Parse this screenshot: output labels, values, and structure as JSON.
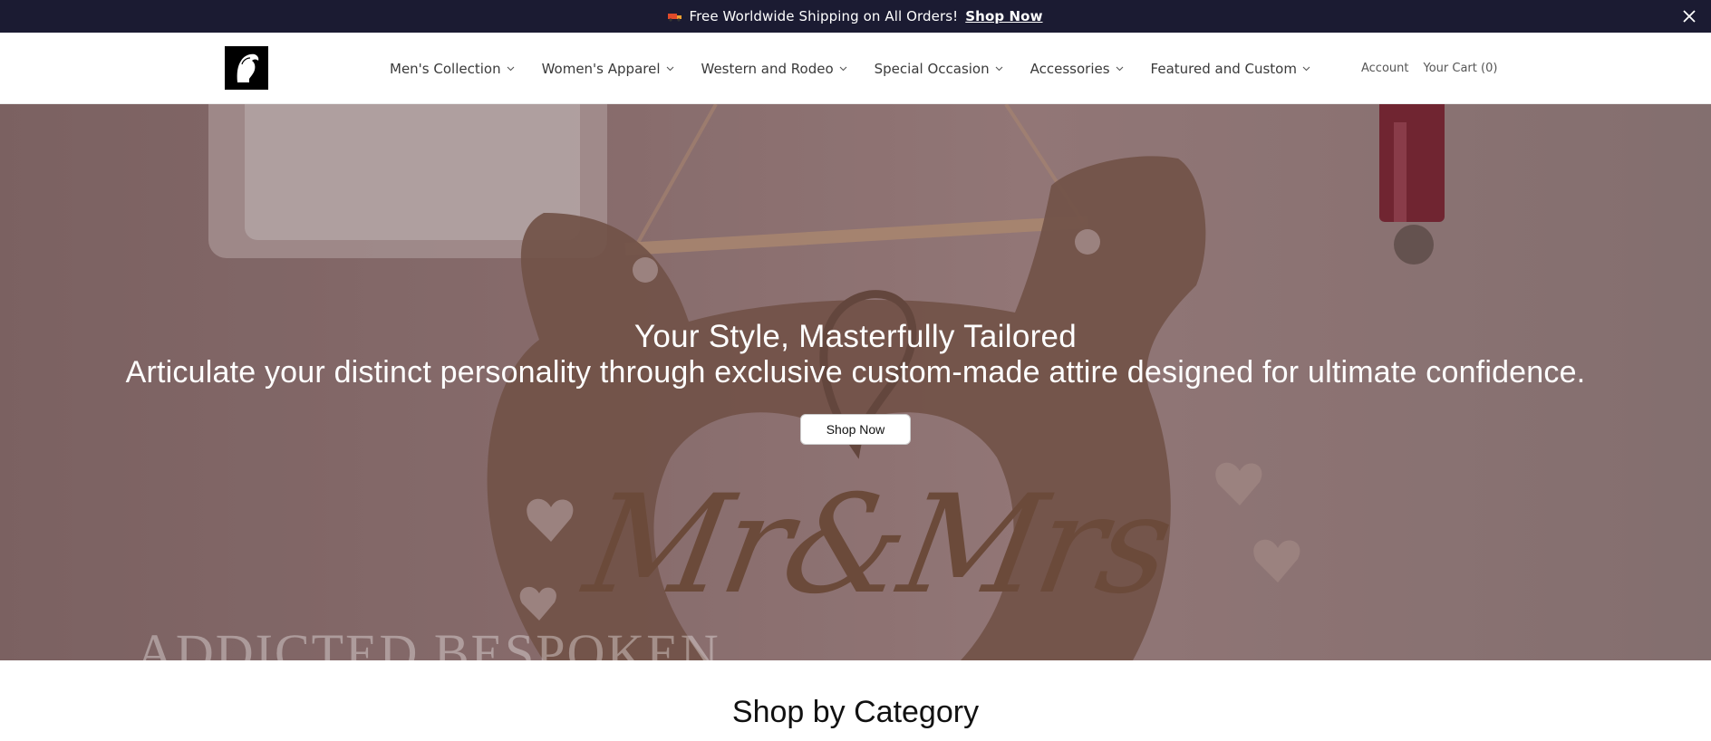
{
  "announcement": {
    "text": "Free Worldwide Shipping on All Orders!",
    "link": "Shop Now",
    "icon": "truck-icon",
    "close_icon": "close-icon"
  },
  "header": {
    "logo": "brand-logo",
    "nav": [
      {
        "label": "Men's Collection"
      },
      {
        "label": "Women's Apparel"
      },
      {
        "label": "Western and Rodeo"
      },
      {
        "label": "Special Occasion"
      },
      {
        "label": "Accessories"
      },
      {
        "label": "Featured and Custom"
      }
    ],
    "account": "Account",
    "cart": "Your Cart (0)"
  },
  "hero": {
    "title": "Your Style, Masterfully Tailored",
    "subtitle": "Articulate your distinct personality through exclusive custom-made attire designed for ultimate confidence.",
    "button": "Shop Now",
    "watermark": "ADDICTED BESPOKEN",
    "sign_text": "Mr&Mrs"
  },
  "sections": {
    "category_title": "Shop by Category"
  },
  "colors": {
    "announcement_bg": "#1b1b32",
    "hero_tint": "#9a7c78",
    "wood": "#7d5a48"
  }
}
